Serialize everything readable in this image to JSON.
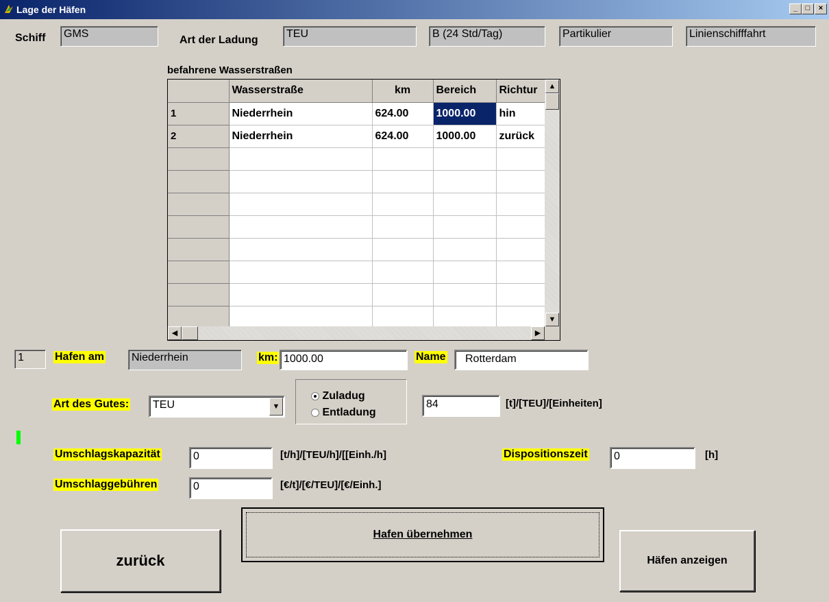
{
  "window": {
    "title": "Lage der Häfen",
    "min": "_",
    "max": "□",
    "close": "×"
  },
  "header": {
    "schiff_label": "Schiff",
    "schiff_value": "GMS",
    "ladung_label": "Art der Ladung",
    "ladung_value": "TEU",
    "betrieb_value": "B  (24 Std/Tag)",
    "eigner_value": "Partikulier",
    "fahrt_value": "Linienschifffahrt"
  },
  "grid": {
    "caption": "befahrene Wasserstraßen",
    "columns": [
      "",
      "Wasserstraße",
      "km",
      "Bereich",
      "Richtur"
    ],
    "rows": [
      [
        "1",
        "Niederrhein",
        "624.00",
        "1000.00",
        "hin"
      ],
      [
        "2",
        "Niederrhein",
        "624.00",
        "1000.00",
        "zurück"
      ],
      [
        "",
        "",
        "",
        "",
        ""
      ],
      [
        "",
        "",
        "",
        "",
        ""
      ],
      [
        "",
        "",
        "",
        "",
        ""
      ],
      [
        "",
        "",
        "",
        "",
        ""
      ],
      [
        "",
        "",
        "",
        "",
        ""
      ],
      [
        "",
        "",
        "",
        "",
        ""
      ],
      [
        "",
        "",
        "",
        "",
        ""
      ],
      [
        "",
        "",
        "",
        "",
        ""
      ]
    ]
  },
  "hafen": {
    "index": "1",
    "label": "Hafen am",
    "waterway": "Niederrhein",
    "km_label": "km:",
    "km_value": "1000.00",
    "name_label": "Name",
    "name_value": "Rotterdam"
  },
  "gut": {
    "label": "Art des Gutes:",
    "value": "TEU",
    "radio_load": "Zuladug",
    "radio_unload": "Entladung",
    "amount": "84",
    "amount_unit": "[t]/[TEU]/[Einheiten]"
  },
  "umschlag": {
    "kap_label": "Umschlagskapazität",
    "kap_value": "0",
    "kap_unit": "[t/h]/[TEU/h]/[[Einh./h]",
    "dispo_label": "Dispositionszeit",
    "dispo_value": "0",
    "dispo_unit": "[h]",
    "geb_label": "Umschlaggebühren",
    "geb_value": "0",
    "geb_unit": "[€/t]/[€/TEU]/[€/Einh.]"
  },
  "buttons": {
    "back": "zurück",
    "accept": "Hafen übernehmen",
    "show": "Häfen anzeigen"
  },
  "colors": {
    "highlight": "#ffff00",
    "indicator": "#00ff00",
    "selection": "#0a246a"
  }
}
